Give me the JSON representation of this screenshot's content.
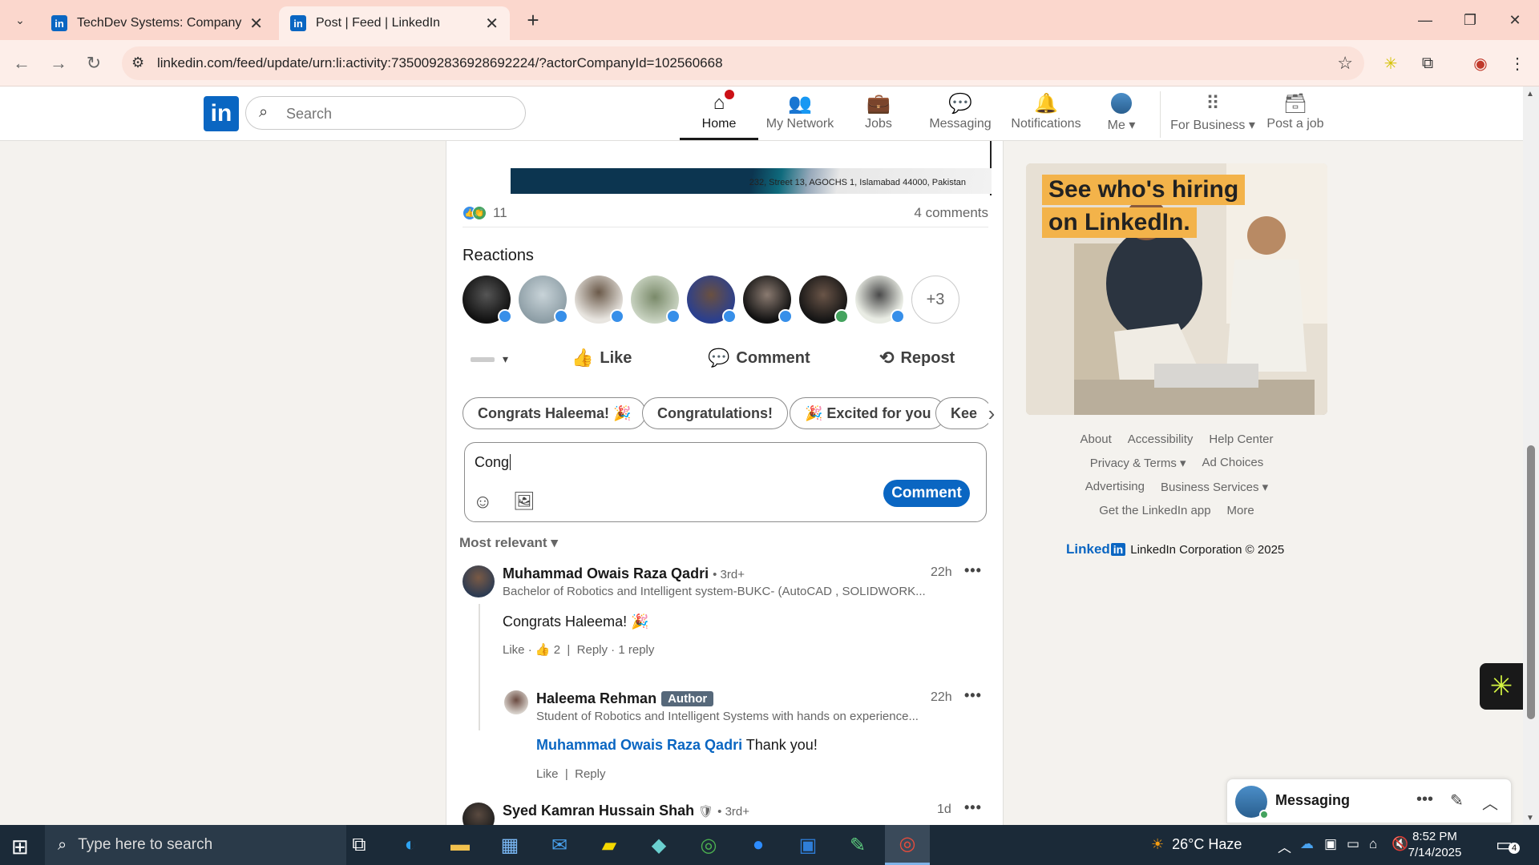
{
  "browser": {
    "tabs": [
      {
        "title": "TechDev Systems: Company Pa",
        "favicon": "linkedin-favicon"
      },
      {
        "title": "Post | Feed | LinkedIn",
        "favicon": "linkedin-favicon"
      }
    ],
    "url": "linkedin.com/feed/update/urn:li:activity:7350092836928692224/?actorCompanyId=102560668"
  },
  "nav": {
    "search_placeholder": "Search",
    "items": [
      {
        "label": "Home",
        "icon": "home-icon"
      },
      {
        "label": "My Network",
        "icon": "network-icon"
      },
      {
        "label": "Jobs",
        "icon": "briefcase-icon"
      },
      {
        "label": "Messaging",
        "icon": "messaging-icon"
      },
      {
        "label": "Notifications",
        "icon": "bell-icon"
      },
      {
        "label": "Me",
        "icon": "avatar"
      },
      {
        "label": "For Business",
        "icon": "grid-icon"
      },
      {
        "label": "Post a job",
        "icon": "post-job-icon"
      }
    ]
  },
  "post": {
    "image_address": "232, Street 13, AGOCHS 1, Islamabad 44000, Pakistan",
    "reaction_count": "11",
    "comment_count": "4 comments",
    "reactions_title": "Reactions",
    "more_reactors": "+3",
    "actions": {
      "like": "Like",
      "comment": "Comment",
      "repost": "Repost"
    },
    "suggestions": [
      "Congrats Haleema! 🎉",
      "Congratulations!",
      "🎉 Excited for you",
      "Kee"
    ],
    "comment_draft": "Cong",
    "comment_button": "Comment",
    "sort_label": "Most relevant"
  },
  "comments": [
    {
      "name": "Muhammad Owais Raza Qadri",
      "degree": "• 3rd+",
      "headline": "Bachelor of Robotics and Intelligent system-BUKC- (AutoCAD , SOLIDWORK...",
      "time": "22h",
      "text": "Congrats Haleema! 🎉",
      "like": "Like",
      "like_count": "2",
      "reply": "Reply",
      "replies": "1 reply"
    },
    {
      "name": "Haleema Rehman",
      "tag": "Author",
      "headline": "Student of Robotics and Intelligent Systems with hands on experience...",
      "time": "22h",
      "mention": "Muhammad Owais Raza Qadri",
      "text": "Thank you!",
      "like": "Like",
      "reply": "Reply"
    },
    {
      "name": "Syed Kamran Hussain Shah",
      "degree": "• 3rd+",
      "time": "1d"
    }
  ],
  "ad": {
    "line1": "See who's hiring",
    "line2": "on LinkedIn."
  },
  "footer": {
    "row1": [
      "About",
      "Accessibility",
      "Help Center"
    ],
    "row2": [
      "Privacy & Terms ▾",
      "Ad Choices"
    ],
    "row3": [
      "Advertising",
      "Business Services ▾"
    ],
    "row4": [
      "Get the LinkedIn app",
      "More"
    ],
    "brand": "Linked",
    "brand_in": "in",
    "copyright": "LinkedIn Corporation © 2025"
  },
  "messaging": {
    "title": "Messaging"
  },
  "taskbar": {
    "search_placeholder": "Type here to search",
    "weather": "26°C  Haze",
    "time": "8:52 PM",
    "date": "7/14/2025",
    "notification_count": "4"
  },
  "colors": {
    "linkedin_blue": "#0a66c2",
    "tab_bar": "#fbd7cd",
    "ad_highlight": "#f3b34a"
  }
}
